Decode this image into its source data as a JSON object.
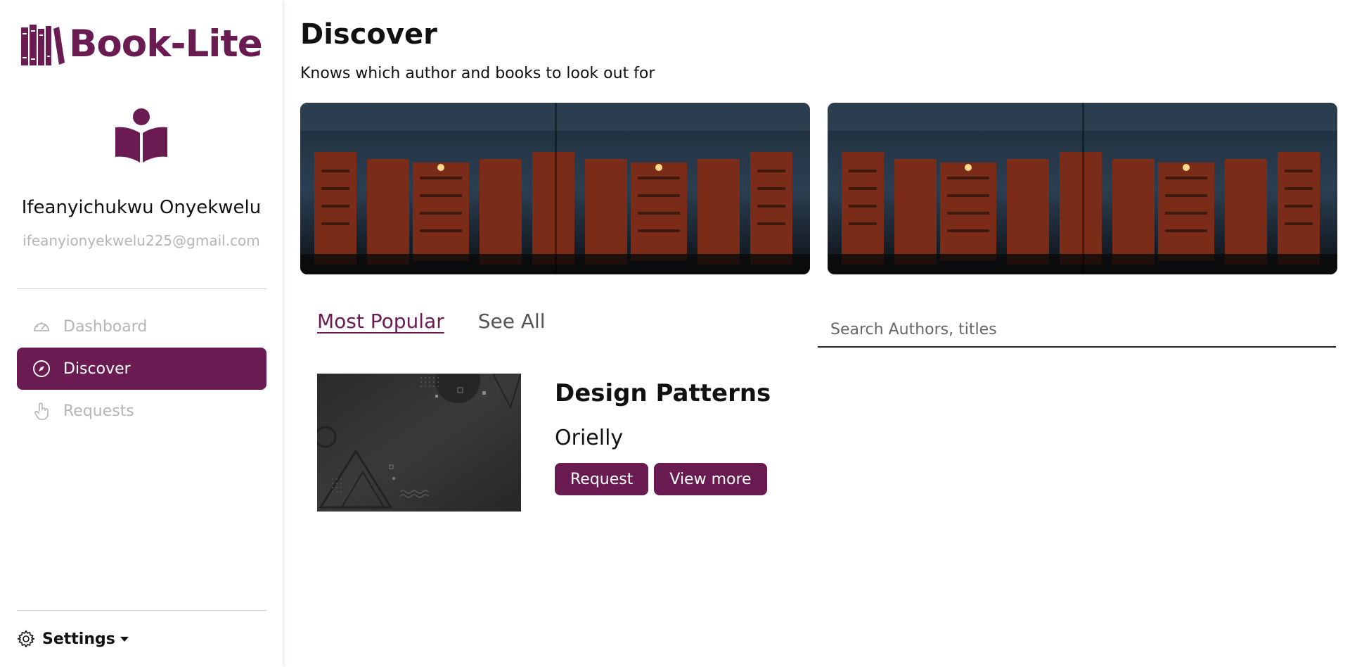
{
  "app": {
    "name": "Book-Lite",
    "brand_color": "#6a1b52"
  },
  "sidebar": {
    "user_name": "Ifeanyichukwu Onyekwelu",
    "user_email": "ifeanyionyekwelu225@gmail.com",
    "items": [
      {
        "label": "Dashboard",
        "icon": "dashboard-gauge-icon",
        "active": false
      },
      {
        "label": "Discover",
        "icon": "compass-icon",
        "active": true
      },
      {
        "label": "Requests",
        "icon": "hand-pointer-icon",
        "active": false
      }
    ],
    "settings_label": "Settings"
  },
  "main": {
    "title": "Discover",
    "subtitle": "Knows which author and books to look out for",
    "tabs": [
      {
        "label": "Most Popular",
        "active": true
      },
      {
        "label": "See All",
        "active": false
      }
    ],
    "search": {
      "placeholder": "Search Authors, titles",
      "value": ""
    },
    "books": [
      {
        "title": "Design Patterns",
        "author": "Orielly",
        "request_label": "Request",
        "view_more_label": "View more"
      }
    ]
  }
}
